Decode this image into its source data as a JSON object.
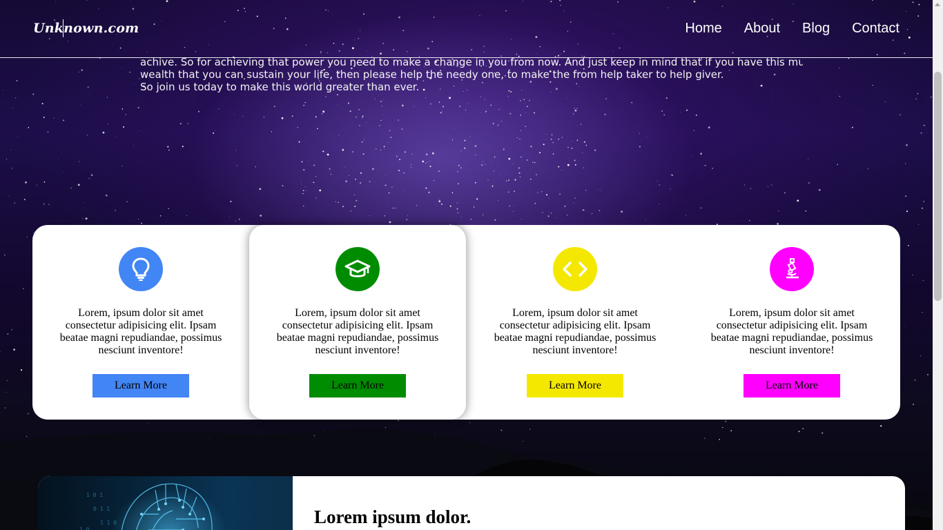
{
  "header": {
    "logo": "Unknown.com",
    "nav": [
      "Home",
      "About",
      "Blog",
      "Contact"
    ]
  },
  "intro": {
    "lines": [
      "achive. So for achieving that power you need to make a change in you from now. And just keep in mind that if you have this much",
      "wealth that you can sustain your life, then please help the needy one, to make the from help taker to help giver.",
      "So join us today to make this world greater than ever."
    ]
  },
  "cards": [
    {
      "icon": "lightbulb-icon",
      "color": "#4285f4",
      "text": "Lorem, ipsum dolor sit amet consectetur adipisicing elit. Ipsam beatae magni repudiandae, possimus nesciunt inventore!",
      "button": "Learn More"
    },
    {
      "icon": "graduation-cap-icon",
      "color": "#008c00",
      "text": "Lorem, ipsum dolor sit amet consectetur adipisicing elit. Ipsam beatae magni repudiandae, possimus nesciunt inventore!",
      "button": "Learn More"
    },
    {
      "icon": "code-icon",
      "color": "#f5e800",
      "text": "Lorem, ipsum dolor sit amet consectetur adipisicing elit. Ipsam beatae magni repudiandae, possimus nesciunt inventore!",
      "button": "Learn More"
    },
    {
      "icon": "microscope-icon",
      "color": "#ff00ff",
      "text": "Lorem, ipsum dolor sit amet consectetur adipisicing elit. Ipsam beatae magni repudiandae, possimus nesciunt inventore!",
      "button": "Learn More"
    }
  ],
  "feature": {
    "title": "Lorem ipsum dolor."
  }
}
